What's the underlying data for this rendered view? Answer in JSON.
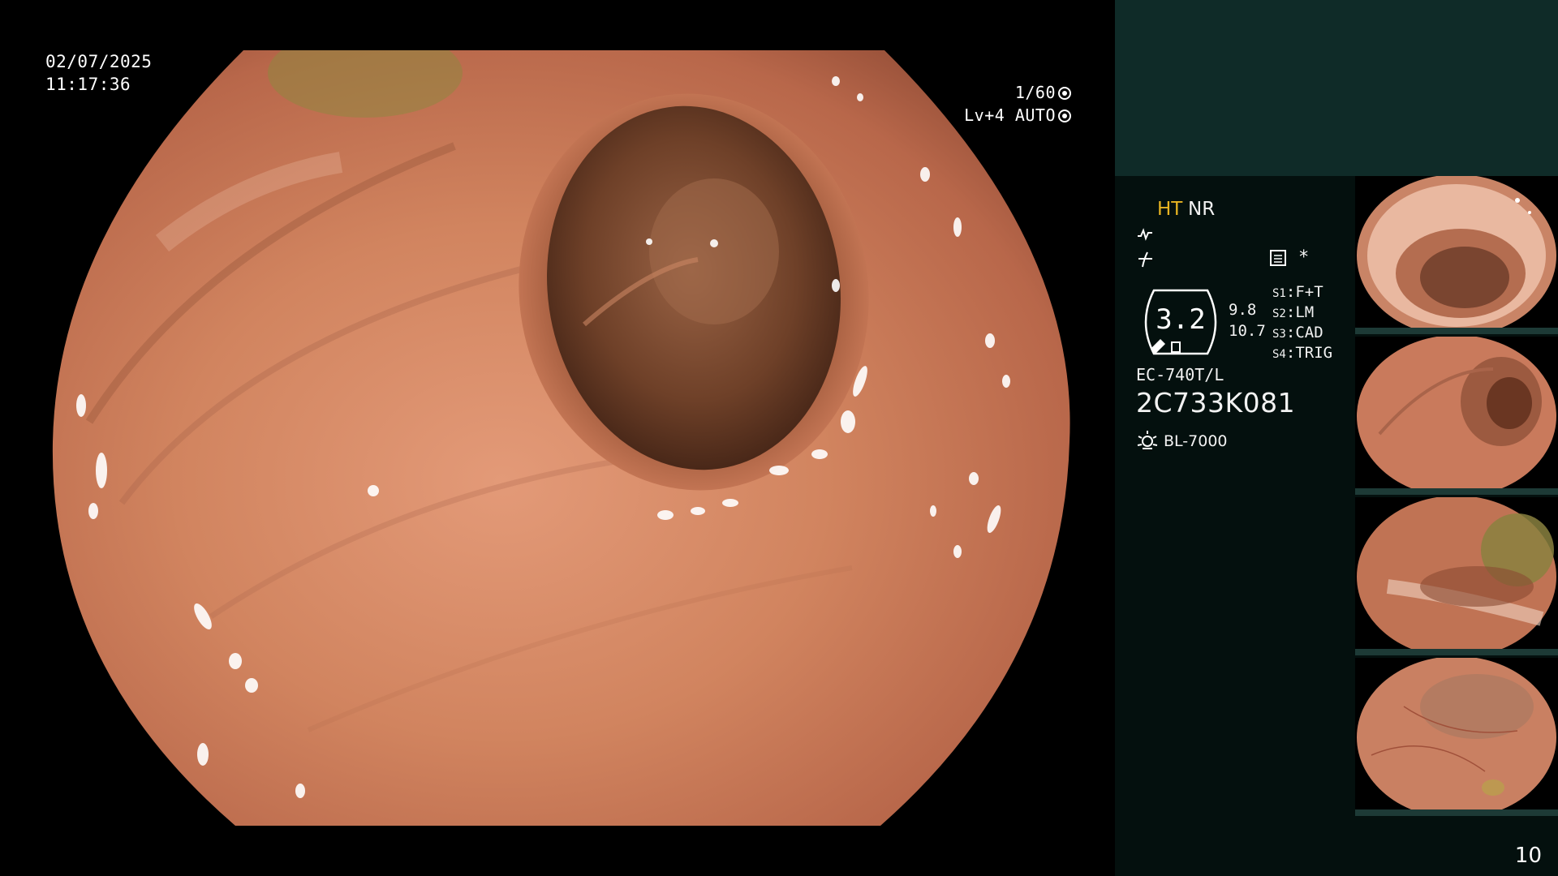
{
  "main_view": {
    "date": "02/07/2025",
    "time": "11:17:36",
    "shutter": "1/60",
    "level": "Lv+4 AUTO"
  },
  "side_panel": {
    "mode_primary": "HT",
    "mode_secondary": "NR",
    "star": "*",
    "dial_value": "3.2",
    "value_a": "9.8",
    "value_b": "10.7",
    "switches": [
      {
        "key": "S1",
        "label": "F+T"
      },
      {
        "key": "S2",
        "label": "LM"
      },
      {
        "key": "S3",
        "label": "CAD"
      },
      {
        "key": "S4",
        "label": "TRIG"
      }
    ],
    "scope_model": "EC-740T/L",
    "scope_serial": "2C733K081",
    "light_source": "BL-7000",
    "page_number": "10"
  },
  "colors": {
    "mode_primary": "#e8b422",
    "panel_top": "#0f2b28",
    "panel_body": "#04100e",
    "mucosa": "#c97a5c"
  },
  "icons": [
    "waveform-icon",
    "curve-icon",
    "document-icon",
    "dial-icon",
    "light-source-icon",
    "shutter-icon",
    "auto-icon"
  ]
}
